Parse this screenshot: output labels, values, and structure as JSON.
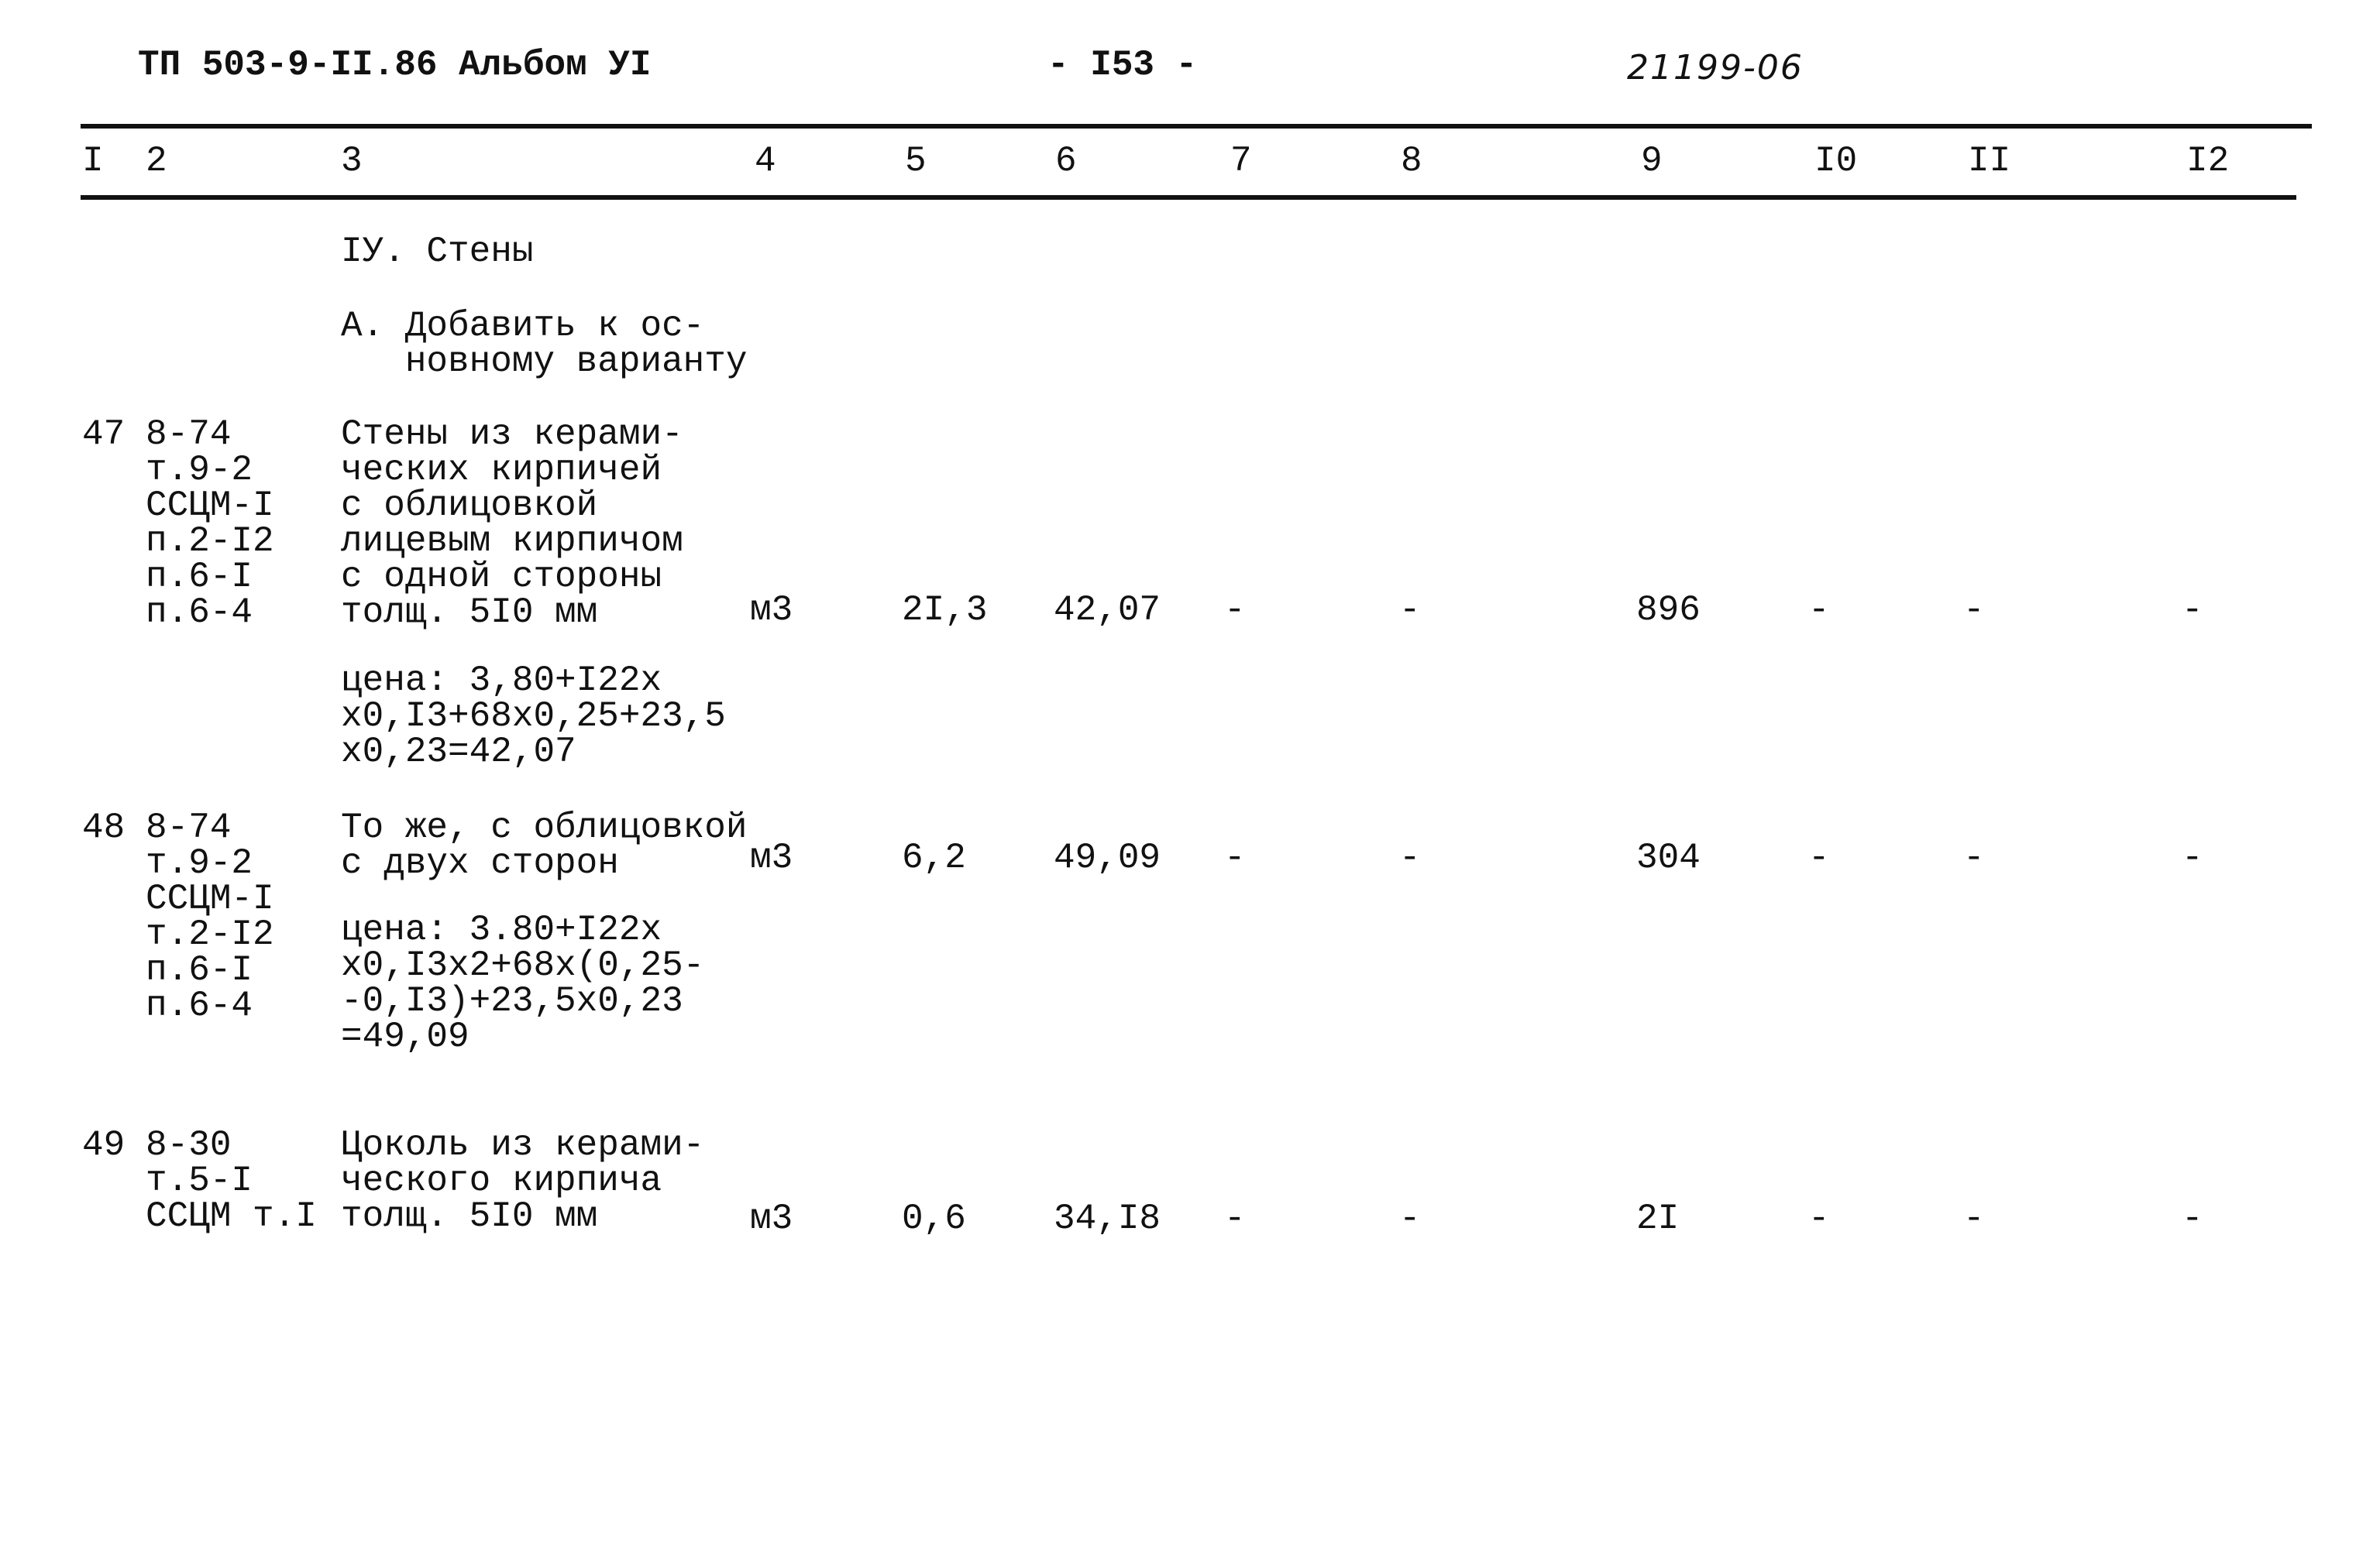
{
  "header": {
    "doc_code": "ТП 503-9-II.86 Альбом УI",
    "page_number": "- I53 -",
    "handwritten_code": "21199-06"
  },
  "columns": [
    "I",
    "2",
    "3",
    "4",
    "5",
    "6",
    "7",
    "8",
    "9",
    "I0",
    "II",
    "I2"
  ],
  "section": {
    "title": "IУ. Стены",
    "subsection": "А. Добавить к ос-\n   новному варианту"
  },
  "rows": [
    {
      "num": "47",
      "code": "8-74\nт.9-2\nССЦМ-I\nп.2-I2\nп.6-I\nп.6-4",
      "description": "Стены из керами-\nческих кирпичей\nс облицовкой\nлицевым кирпичом\nс одной стороны\nтолщ. 5I0 мм",
      "unit": "м3",
      "qty": "2I,3",
      "price": "42,07",
      "c7": "-",
      "c8": "-",
      "c9": "896",
      "c10": "-",
      "c11": "-",
      "c12": "-",
      "price_note": "цена: 3,80+I22х\nх0,I3+68х0,25+23,5\nх0,23=42,07"
    },
    {
      "num": "48",
      "code": "8-74\nт.9-2\nССЦМ-I\nт.2-I2\nп.6-I\nп.6-4",
      "description": "То же, с облицовкой\nс двух сторон",
      "unit": "м3",
      "qty": "6,2",
      "price": "49,09",
      "c7": "-",
      "c8": "-",
      "c9": "304",
      "c10": "-",
      "c11": "-",
      "c12": "-",
      "price_note": "цена: 3.80+I22х\nх0,I3х2+68х(0,25-\n-0,I3)+23,5х0,23\n=49,09"
    },
    {
      "num": "49",
      "code": "8-30\nт.5-I\nССЦМ т.I",
      "description": "Цоколь из керами-\nческого кирпича\nтолщ. 5I0 мм",
      "unit": "м3",
      "qty": "0,6",
      "price": "34,I8",
      "c7": "-",
      "c8": "-",
      "c9": "2I",
      "c10": "-",
      "c11": "-",
      "c12": "-"
    }
  ]
}
